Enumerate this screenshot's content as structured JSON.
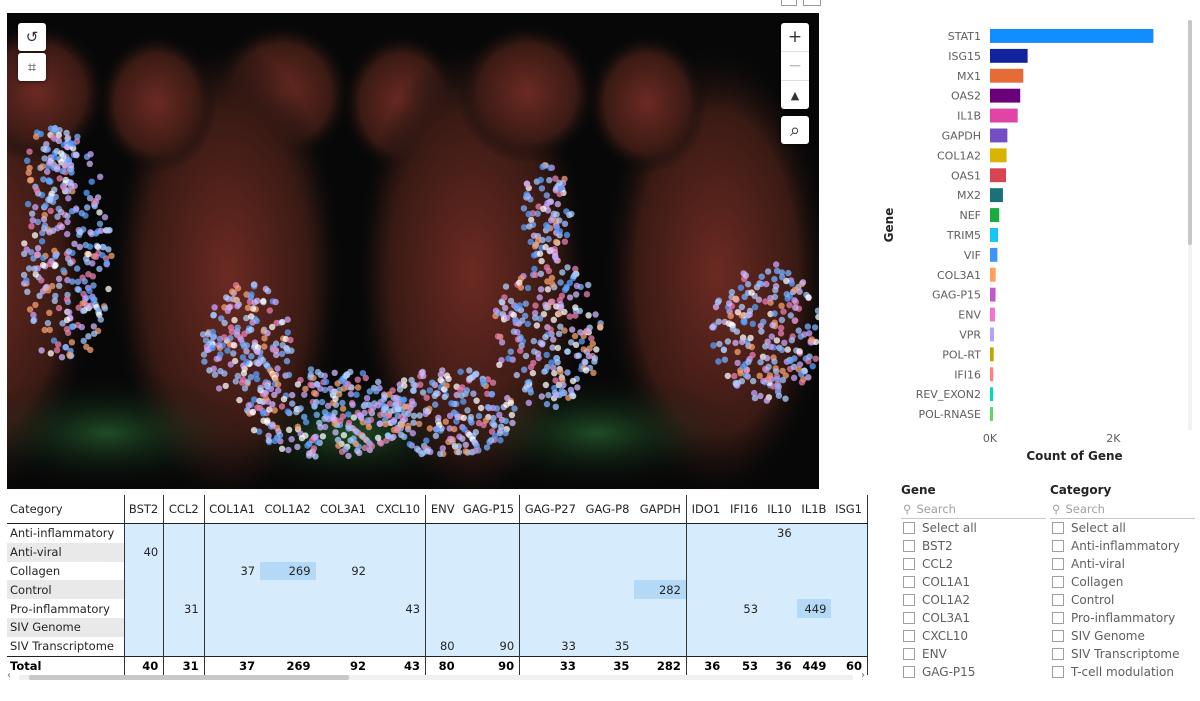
{
  "map_controls": {
    "reset_view": "↺",
    "lasso": "⌗",
    "zoom_in": "+",
    "zoom_out": "−",
    "north": "▲",
    "search_area": "⌕"
  },
  "chart_data": {
    "type": "bar",
    "orientation": "horizontal",
    "categories": [
      "STAT1",
      "ISG15",
      "MX1",
      "OAS2",
      "IL1B",
      "GAPDH",
      "COL1A2",
      "OAS1",
      "MX2",
      "NEF",
      "TRIM5",
      "VIF",
      "COL3A1",
      "GAG-P15",
      "ENV",
      "VPR",
      "POL-RT",
      "IFI16",
      "REV_EXON2",
      "POL-RNASE"
    ],
    "values": [
      2650,
      610,
      540,
      490,
      449,
      282,
      269,
      260,
      210,
      150,
      130,
      120,
      92,
      90,
      80,
      65,
      60,
      53,
      50,
      48
    ],
    "colors": [
      "#118DFF",
      "#12239E",
      "#E66C37",
      "#6B007B",
      "#E044A7",
      "#744EC2",
      "#D9B300",
      "#D64550",
      "#197278",
      "#1AAB40",
      "#15C6F4",
      "#4092FF",
      "#FFA058",
      "#BE5DC9",
      "#F472D0",
      "#B5A1FF",
      "#C4A200",
      "#FF8080",
      "#00DBBC",
      "#5BD667"
    ],
    "xlabel": "Count of Gene",
    "ylabel": "Gene",
    "xticks": [
      "0K",
      "2K"
    ],
    "xlim": [
      0,
      3000
    ]
  },
  "matrix": {
    "header_category": "Category",
    "columns": [
      "BST2",
      "CCL2",
      "COL1A1",
      "COL1A2",
      "COL3A1",
      "CXCL10",
      "ENV",
      "GAG-P15",
      "GAG-P27",
      "GAG-P8",
      "GAPDH",
      "IDO1",
      "IFI16",
      "IL10",
      "IL1B",
      "ISG1"
    ],
    "rows": [
      {
        "label": "Anti-inflammatory",
        "cells": [
          "",
          "",
          "",
          "",
          "",
          "",
          "",
          "",
          "",
          "",
          "",
          "",
          "",
          "36",
          "",
          ""
        ]
      },
      {
        "label": "Anti-viral",
        "cells": [
          "40",
          "",
          "",
          "",
          "",
          "",
          "",
          "",
          "",
          "",
          "",
          "",
          "",
          "",
          "",
          ""
        ]
      },
      {
        "label": "Collagen",
        "cells": [
          "",
          "",
          "37",
          "269",
          "92",
          "",
          "",
          "",
          "",
          "",
          "",
          "",
          "",
          "",
          "",
          ""
        ]
      },
      {
        "label": "Control",
        "cells": [
          "",
          "",
          "",
          "",
          "",
          "",
          "",
          "",
          "",
          "",
          "282",
          "",
          "",
          "",
          "",
          ""
        ]
      },
      {
        "label": "Pro-inflammatory",
        "cells": [
          "",
          "31",
          "",
          "",
          "",
          "43",
          "",
          "",
          "",
          "",
          "",
          "",
          "53",
          "",
          "449",
          ""
        ]
      },
      {
        "label": "SIV Genome",
        "cells": [
          "",
          "",
          "",
          "",
          "",
          "",
          "",
          "",
          "",
          "",
          "",
          "",
          "",
          "",
          "",
          ""
        ]
      },
      {
        "label": "SIV Transcriptome",
        "cells": [
          "",
          "",
          "",
          "",
          "",
          "",
          "80",
          "90",
          "33",
          "35",
          "",
          "",
          "",
          "",
          "",
          ""
        ]
      }
    ],
    "total": {
      "label": "Total",
      "cells": [
        "40",
        "31",
        "37",
        "269",
        "92",
        "43",
        "80",
        "90",
        "33",
        "35",
        "282",
        "36",
        "53",
        "36",
        "449",
        "60"
      ]
    }
  },
  "slicer_gene": {
    "title": "Gene",
    "search_placeholder": "Search",
    "items": [
      "Select all",
      "BST2",
      "CCL2",
      "COL1A1",
      "COL1A2",
      "COL3A1",
      "CXCL10",
      "ENV",
      "GAG-P15"
    ]
  },
  "slicer_category": {
    "title": "Category",
    "search_placeholder": "Search",
    "items": [
      "Select all",
      "Anti-inflammatory",
      "Anti-viral",
      "Collagen",
      "Control",
      "Pro-inflammatory",
      "SIV Genome",
      "SIV Transcriptome",
      "T-cell modulation"
    ]
  }
}
